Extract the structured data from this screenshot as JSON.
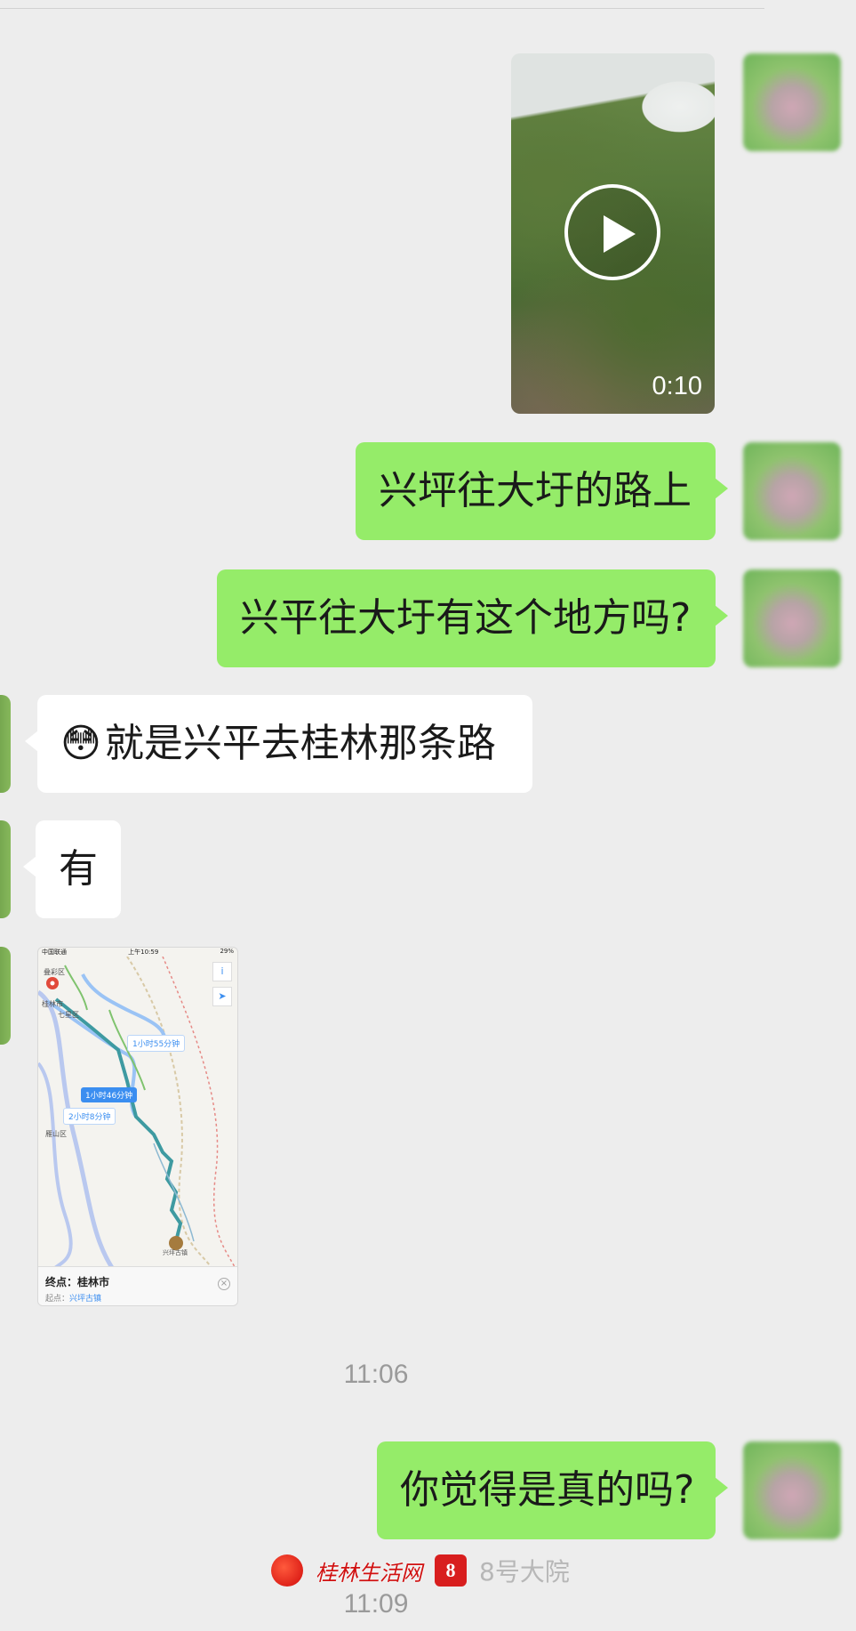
{
  "messages": {
    "video_duration": "0:10",
    "msg1": "兴坪往大圩的路上",
    "msg2": "兴平往大圩有这个地方吗?",
    "msg3_emoji": "😳",
    "msg3": "就是兴平去桂林那条路",
    "msg4": "有",
    "msg5": "你觉得是真的吗?"
  },
  "map": {
    "status_carrier": "中国联通",
    "status_time": "上午10:59",
    "status_battery": "29%",
    "route_label_1": "1小时55分钟",
    "route_label_2": "1小时46分钟",
    "route_label_3": "2小时8分钟",
    "place_top": "叠彩区",
    "place_city": "桂林市",
    "place_qixing": "七星区",
    "place_yanshan": "雁山区",
    "place_dest": "兴坪古镇",
    "footer_dest_label": "终点：",
    "footer_dest": "桂林市",
    "footer_start_label": "起点：",
    "footer_start": "兴坪古镇"
  },
  "timestamps": {
    "t1": "11:06",
    "t2": "11:09"
  },
  "watermark": {
    "site": "桂林生活网",
    "site2": "8号大院",
    "logo2_char": "8"
  }
}
